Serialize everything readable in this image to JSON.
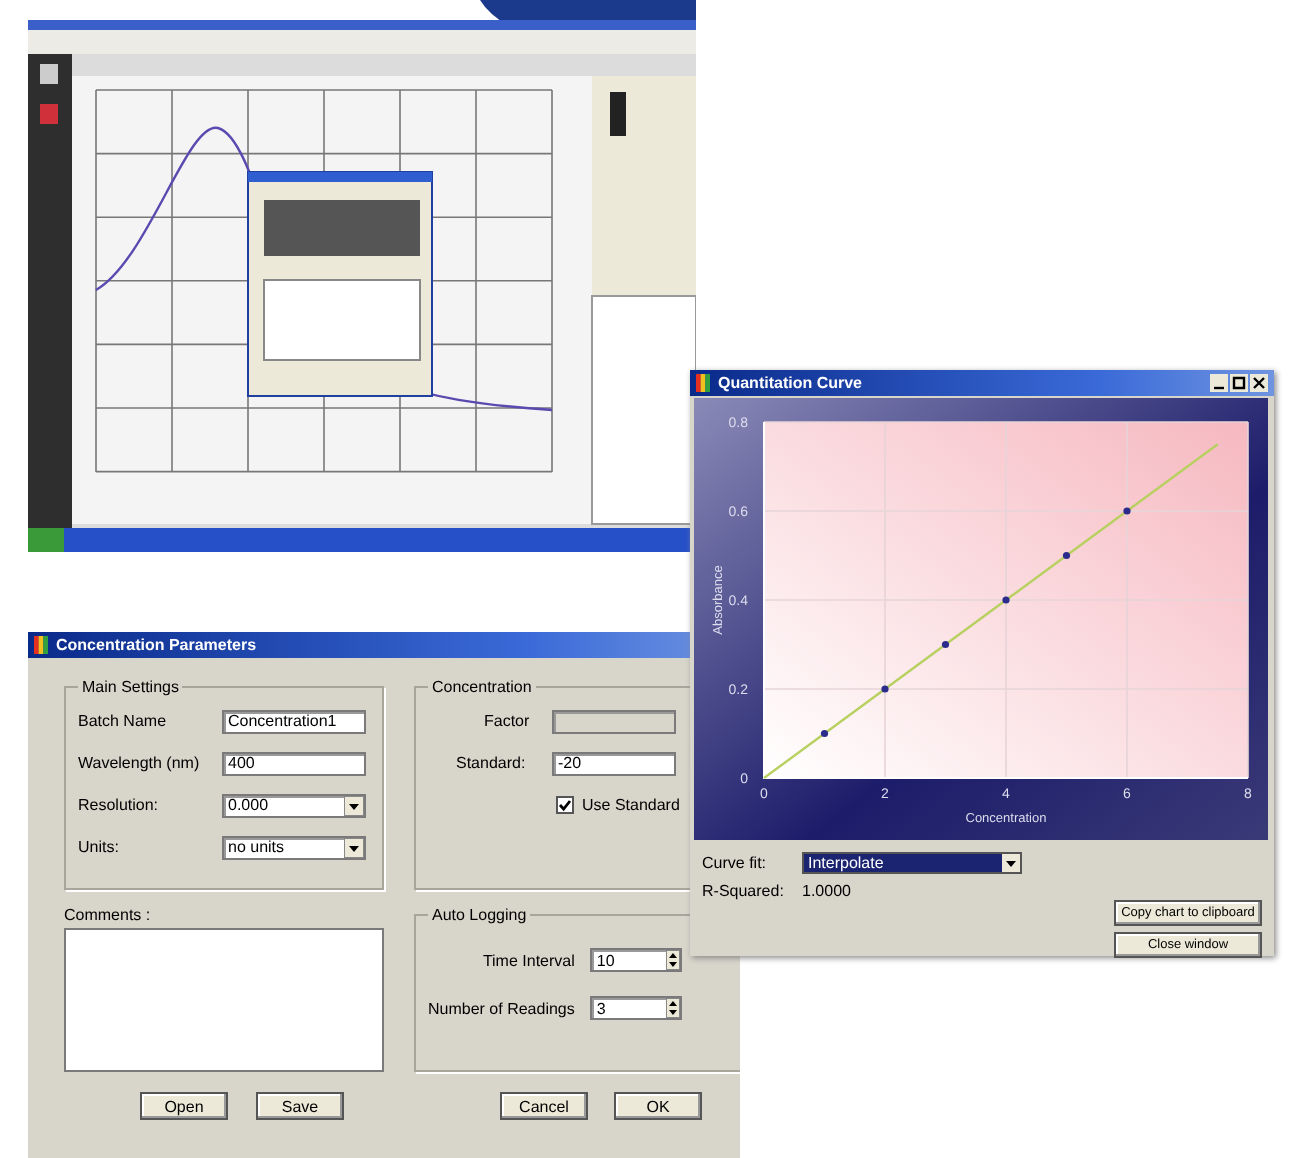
{
  "quantitation_window": {
    "title": "Quantitation Curve",
    "chart": {
      "chart_data": {
        "type": "line",
        "xlabel": "Concentration",
        "ylabel": "Absorbance",
        "x": [
          0,
          1,
          2,
          3,
          4,
          5,
          6,
          7.5
        ],
        "series": [
          {
            "color": "#b8d060",
            "values": [
              0,
              0.1,
              0.2,
              0.3,
              0.4,
              0.5,
              0.6,
              0.75
            ]
          }
        ],
        "xlim": [
          0,
          8
        ],
        "ylim": [
          0,
          0.8
        ],
        "xticks": [
          0,
          2,
          4,
          6,
          8
        ],
        "yticks": [
          0,
          0.2,
          0.4,
          0.6,
          0.8
        ],
        "grid": true
      }
    },
    "curve_fit": {
      "label": "Curve fit:",
      "value": "Interpolate"
    },
    "r_squared": {
      "label": "R-Squared:",
      "value": "1.0000"
    },
    "buttons": [
      "Copy chart to clipboard",
      "Close window"
    ]
  },
  "concentration_window": {
    "title": "Concentration Parameters",
    "main_settings": {
      "title": "Main Settings",
      "fields": [
        {
          "kind": "text",
          "label": "Batch Name",
          "value": "Concentration1"
        },
        {
          "kind": "text",
          "label": "Wavelength (nm)",
          "value": "400"
        },
        {
          "kind": "dropdown",
          "label": "Resolution:",
          "value": "0.000"
        },
        {
          "kind": "dropdown",
          "label": "Units:",
          "value": "no units"
        }
      ]
    },
    "concentration": {
      "title": "Concentration",
      "factor": {
        "label": "Factor",
        "disabled": true
      },
      "standard": {
        "label": "Standard:",
        "value": "-20"
      },
      "use_standard": {
        "label": "Use Standard",
        "checked": true
      }
    },
    "comments": {
      "label": "Comments :"
    },
    "auto_logging": {
      "title": "Auto Logging",
      "fields": [
        {
          "label": "Time Interval",
          "value": "10"
        },
        {
          "label": "Number of Readings",
          "value": "3"
        }
      ]
    },
    "buttons": [
      "Open",
      "Save",
      "Cancel",
      "OK"
    ]
  }
}
